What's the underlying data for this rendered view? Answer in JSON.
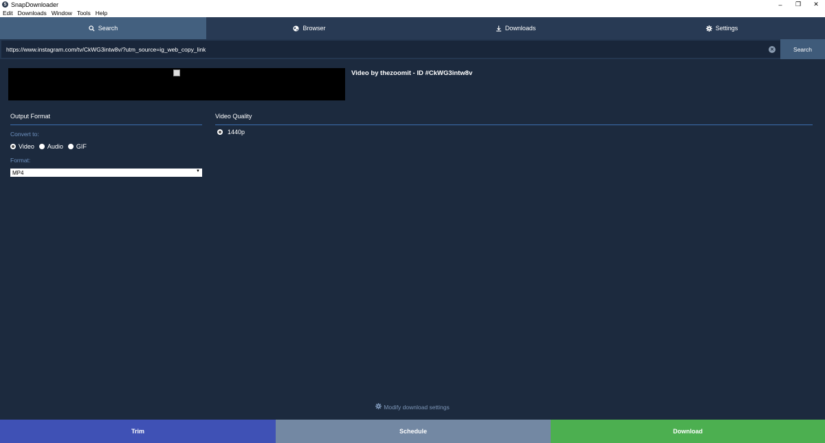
{
  "window": {
    "title": "SnapDownloader",
    "logo_letter": "S",
    "controls": {
      "minimize": "–",
      "restore": "❐",
      "close": "✕"
    }
  },
  "menu": [
    "Edit",
    "Downloads",
    "Window",
    "Tools",
    "Help"
  ],
  "tabs": [
    {
      "label": "Search",
      "icon": "search-icon",
      "active": true
    },
    {
      "label": "Browser",
      "icon": "globe-icon",
      "active": false
    },
    {
      "label": "Downloads",
      "icon": "download-icon",
      "active": false
    },
    {
      "label": "Settings",
      "icon": "gear-icon",
      "active": false
    }
  ],
  "search": {
    "url": "https://www.instagram.com/tv/CkWG3intw8v/?utm_source=ig_web_copy_link",
    "clear_glyph": "✕",
    "button_label": "Search"
  },
  "video": {
    "title": "Video by thezoomit - ID #CkWG3intw8v"
  },
  "output_format": {
    "heading": "Output Format",
    "convert_label": "Convert to:",
    "options": [
      {
        "label": "Video",
        "checked": true
      },
      {
        "label": "Audio",
        "checked": false
      },
      {
        "label": "GIF",
        "checked": false
      }
    ],
    "format_label": "Format:",
    "format_value": "MP4",
    "format_arrow": "▼"
  },
  "video_quality": {
    "heading": "Video Quality",
    "options": [
      {
        "label": "1440p",
        "checked": true
      }
    ]
  },
  "modify_settings": {
    "label": "Modify download settings",
    "icon": "gear-icon"
  },
  "actions": {
    "trim": "Trim",
    "schedule": "Schedule",
    "download": "Download"
  },
  "colors": {
    "background": "#1c2a3e",
    "tab_active": "#43607f",
    "trim": "#3f51b5",
    "schedule": "#7388a3",
    "download": "#4caf50",
    "accent_line": "#3c6fb0"
  }
}
